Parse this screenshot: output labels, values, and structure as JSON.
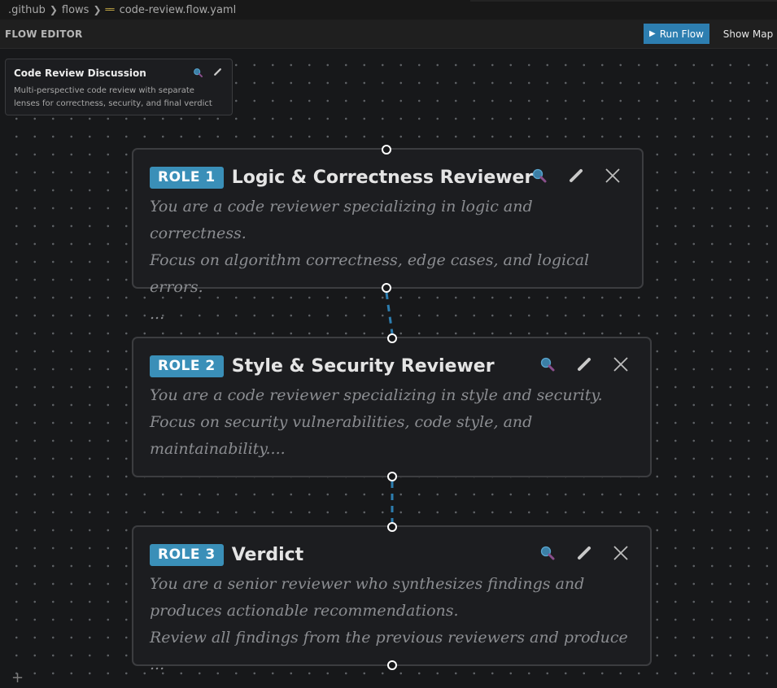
{
  "breadcrumb": {
    "parts": [
      ".github",
      "flows"
    ],
    "file": "code-review.flow.yaml"
  },
  "header": {
    "title": "FLOW EDITOR",
    "run_label": "Run Flow",
    "map_label": "Show Map"
  },
  "flow": {
    "name": "Code Review Discussion",
    "description": "Multi-perspective code review with separate lenses for correctness, security, and final verdict"
  },
  "roles": [
    {
      "badge": "ROLE 1",
      "title": "Logic & Correctness Reviewer",
      "lines": [
        "You are a code reviewer specializing in logic and correctness.",
        "Focus on algorithm correctness, edge cases, and logical errors.",
        "..."
      ]
    },
    {
      "badge": "ROLE 2",
      "title": "Style & Security Reviewer",
      "lines": [
        "You are a code reviewer specializing in style and security.",
        "Focus on security vulnerabilities, code style, and",
        "maintainability...."
      ]
    },
    {
      "badge": "ROLE 3",
      "title": "Verdict",
      "lines": [
        "You are a senior reviewer who synthesizes findings and",
        "produces actionable recommendations.",
        "Review all findings from the previous reviewers and produce ..."
      ]
    }
  ],
  "colors": {
    "accent": "#3a8fb8",
    "connector": "#2d7eb0",
    "canvas": "#17181a"
  },
  "icons": [
    "yaml-file-icon",
    "play-icon",
    "search-icon",
    "pencil-icon",
    "close-icon",
    "add-icon"
  ]
}
